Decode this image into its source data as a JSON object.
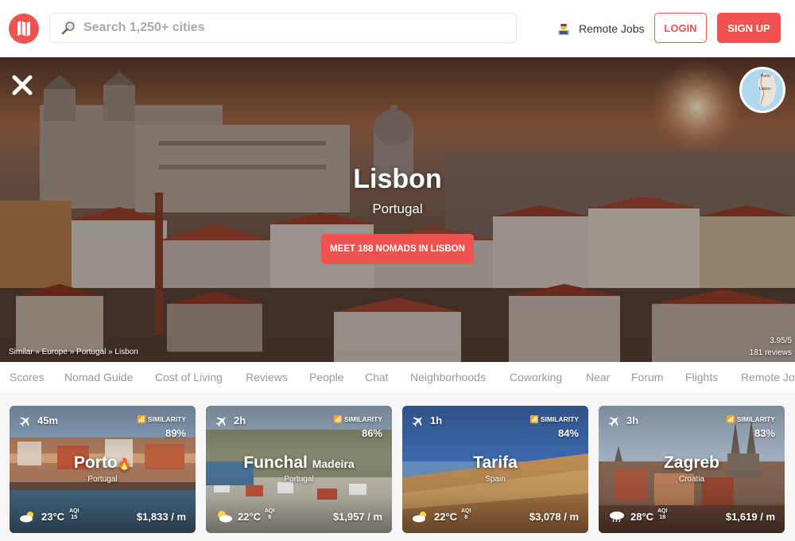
{
  "header": {
    "logo_icon": "nomad-list-logo-icon",
    "search_placeholder": "Search 1,250+ cities",
    "remote_jobs_label": "Remote Jobs",
    "login_label": "LOGIN",
    "signup_label": "SIGN UP",
    "accent_color": "#ef5350"
  },
  "hero": {
    "city": "Lisbon",
    "country": "Portugal",
    "meet_button": "MEET 188 NOMADS IN LISBON",
    "breadcrumb": "Similar » Europe » Portugal » Lisbon",
    "rating": "3.95/5",
    "reviews": "181 reviews",
    "map_labels": [
      "Porto",
      "Lisbon"
    ]
  },
  "tabs": [
    "Scores",
    "Nomad Guide",
    "Cost of Living",
    "Reviews",
    "People",
    "Chat",
    "Neighborhoods",
    "Coworking",
    "Near",
    "Forum",
    "Flights",
    "Remote Jobs"
  ],
  "cards": [
    {
      "flight": "45m",
      "similarity_label": "SIMILARITY",
      "similarity": "89%",
      "name": "Porto",
      "name_suffix": "🔥",
      "country": "Portugal",
      "temp": "23°C",
      "aqi_label": "AQI",
      "aqi": "15",
      "cost": "$1,833 / m",
      "weather_icon": "partly-cloudy-icon"
    },
    {
      "flight": "2h",
      "similarity_label": "SIMILARITY",
      "similarity": "86%",
      "name": "Funchal",
      "name_suffix": "Madeira",
      "country": "Portugal",
      "temp": "22°C",
      "aqi_label": "AQI",
      "aqi": "8",
      "cost": "$1,957 / m",
      "weather_icon": "sun-cloud-icon"
    },
    {
      "flight": "1h",
      "similarity_label": "SIMILARITY",
      "similarity": "84%",
      "name": "Tarifa",
      "name_suffix": "",
      "country": "Spain",
      "temp": "22°C",
      "aqi_label": "AQI",
      "aqi": "8",
      "cost": "$3,078 / m",
      "weather_icon": "partly-cloudy-icon"
    },
    {
      "flight": "3h",
      "similarity_label": "SIMILARITY",
      "similarity": "83%",
      "name": "Zagreb",
      "name_suffix": "",
      "country": "Croatia",
      "temp": "28°C",
      "aqi_label": "AQI",
      "aqi": "18",
      "cost": "$1,619 / m",
      "weather_icon": "rain-cloud-icon"
    }
  ]
}
